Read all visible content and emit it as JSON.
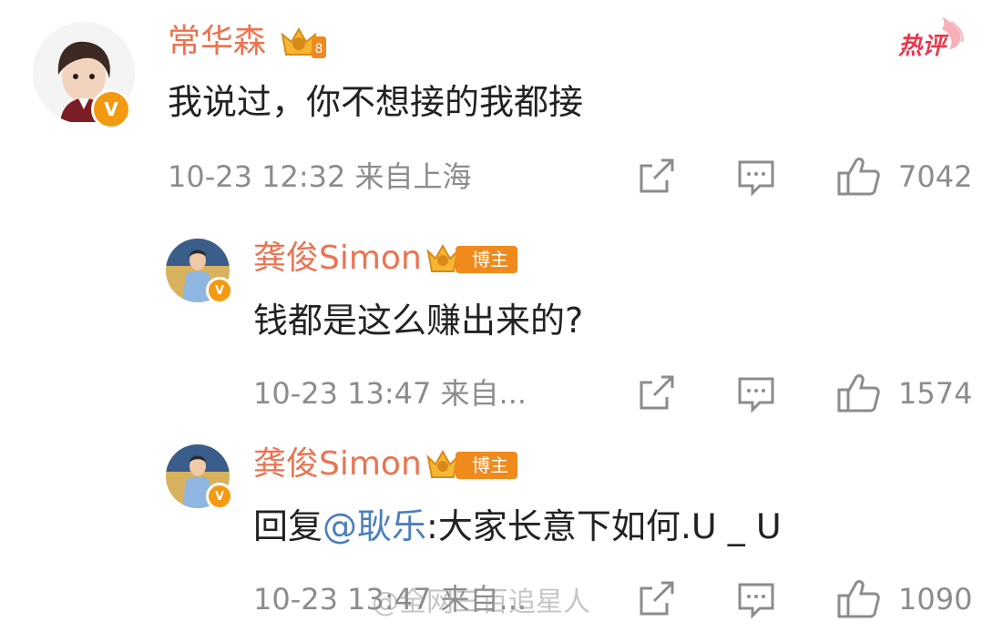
{
  "hot_badge": "热评",
  "watermark": "@全网三百追星人",
  "main_comment": {
    "username": "常华森",
    "verified_badge": "V",
    "content": "我说过，你不想接的我都接",
    "time": "10-23 12:32",
    "location": "来自上海",
    "likes": "7042"
  },
  "replies": [
    {
      "username": "龚俊Simon",
      "author_tag": "博主",
      "verified_badge": "V",
      "content": "钱都是这么赚出来的?",
      "time": "10-23 13:47",
      "location": "来自...",
      "likes": "1574"
    },
    {
      "username": "龚俊Simon",
      "author_tag": "博主",
      "verified_badge": "V",
      "content_prefix": "回复",
      "mention": "@耿乐",
      "content_suffix": ":大家长意下如何.ᑌ _ ᑌ",
      "time": "10-23 13:47",
      "location": "来自...",
      "likes": "1090"
    }
  ],
  "colors": {
    "username": "#eb7350",
    "mention": "#4a7fbd",
    "meta": "#8c8c8c",
    "badge_orange": "#f39a11",
    "hot_red": "#e8384f"
  },
  "icons": [
    "share-icon",
    "comment-icon",
    "like-icon",
    "crown-icon",
    "verified-icon"
  ]
}
